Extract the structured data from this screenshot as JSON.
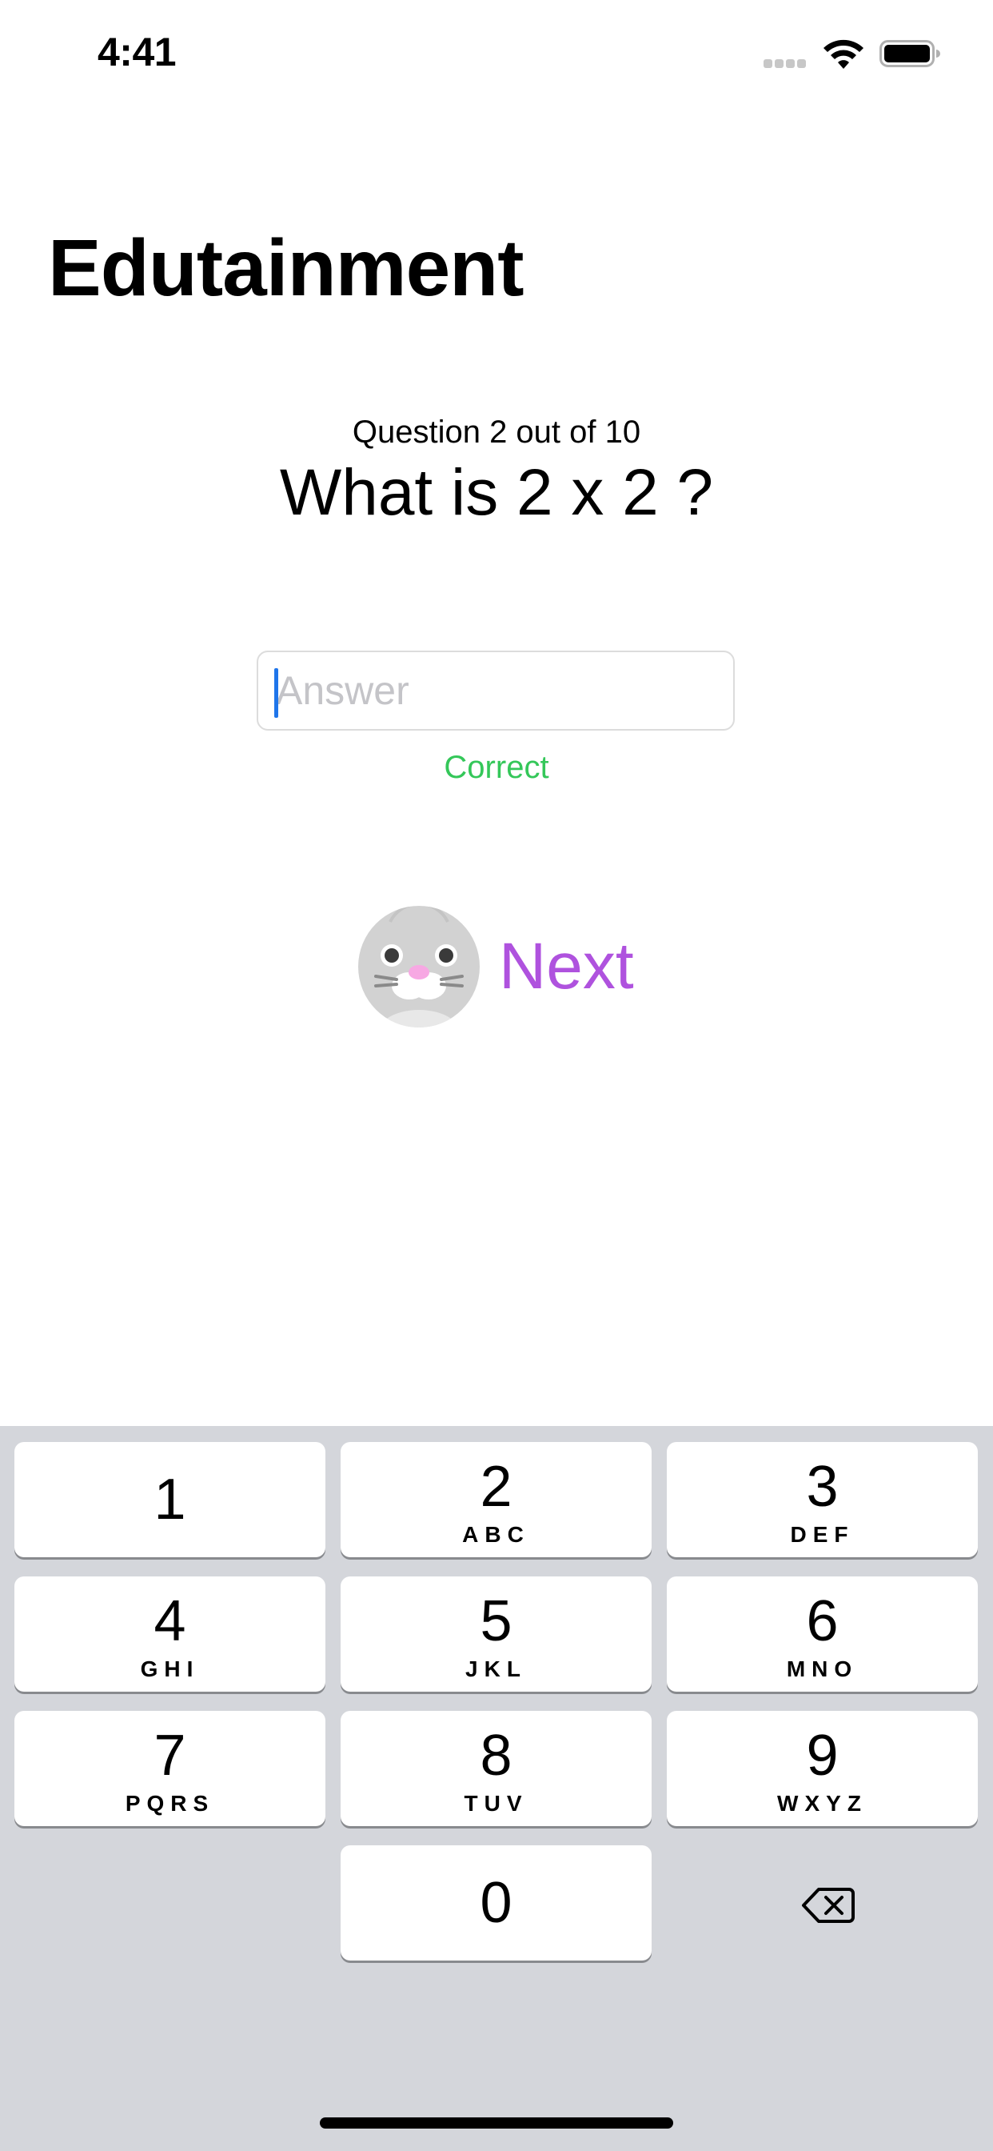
{
  "status_bar": {
    "time": "4:41"
  },
  "nav": {
    "title": "Edutainment"
  },
  "quiz": {
    "counter": "Question 2 out of 10",
    "question": "What is 2 x 2 ?",
    "answer_value": "",
    "answer_placeholder": "Answer",
    "feedback": "Correct",
    "feedback_color": "#34c759"
  },
  "next_button": {
    "label": "Next",
    "color": "#af52de",
    "icon": "seal-avatar-icon"
  },
  "keyboard": {
    "keys": [
      {
        "digit": "1",
        "letters": ""
      },
      {
        "digit": "2",
        "letters": "ABC"
      },
      {
        "digit": "3",
        "letters": "DEF"
      },
      {
        "digit": "4",
        "letters": "GHI"
      },
      {
        "digit": "5",
        "letters": "JKL"
      },
      {
        "digit": "6",
        "letters": "MNO"
      },
      {
        "digit": "7",
        "letters": "PQRS"
      },
      {
        "digit": "8",
        "letters": "TUV"
      },
      {
        "digit": "9",
        "letters": "WXYZ"
      },
      {
        "digit": "0",
        "letters": ""
      }
    ],
    "delete_icon": "delete-backspace-icon"
  }
}
